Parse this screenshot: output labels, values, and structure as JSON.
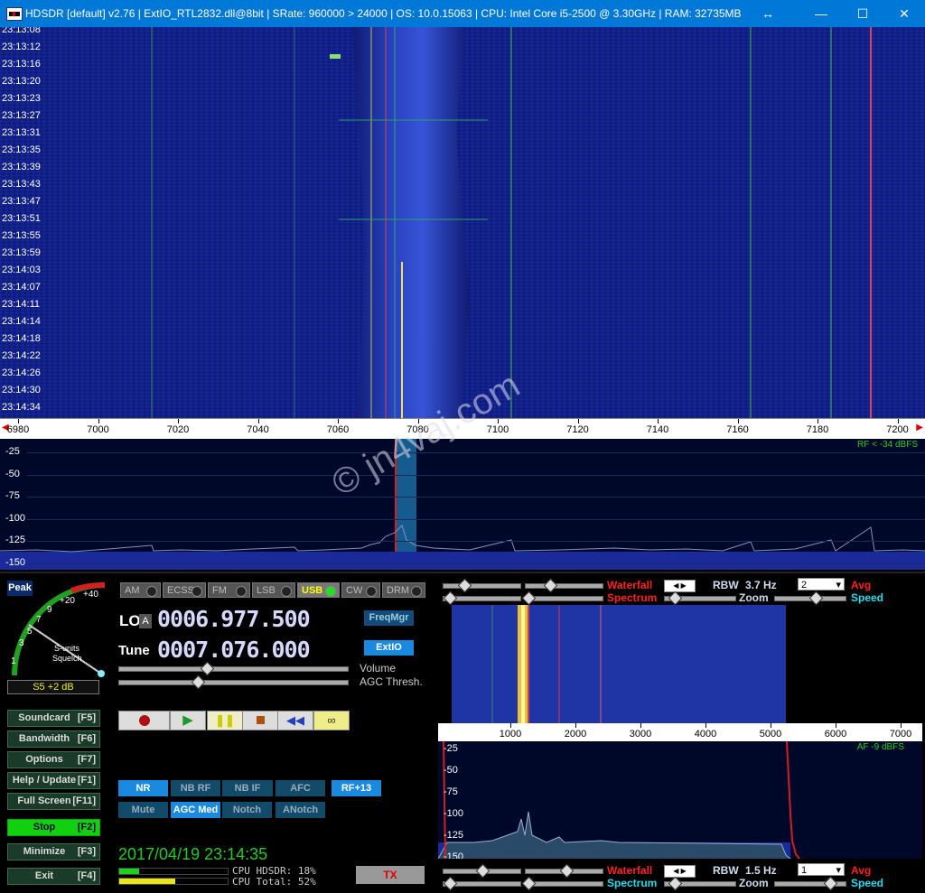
{
  "titlebar": {
    "title": "HDSDR  [default]  v2.76   |  ExtIO_RTL2832.dll@8bit  |  SRate: 960000 > 24000  |  OS: 10.0.15063   |  CPU: Intel Core i5-2500 @ 3.30GHz  |  RAM: 32735MB",
    "resize_icon": "↔",
    "minimize": "—",
    "maximize": "☐",
    "close": "✕"
  },
  "waterfall": {
    "timestamps": [
      "23:13:08",
      "23:13:12",
      "23:13:16",
      "23:13:20",
      "23:13:23",
      "23:13:27",
      "23:13:31",
      "23:13:35",
      "23:13:39",
      "23:13:43",
      "23:13:47",
      "23:13:51",
      "23:13:55",
      "23:13:59",
      "23:14:03",
      "23:14:07",
      "23:14:11",
      "23:14:14",
      "23:14:18",
      "23:14:22",
      "23:14:26",
      "23:14:30",
      "23:14:34"
    ],
    "freq_ticks": [
      "6980",
      "7000",
      "7020",
      "7040",
      "7060",
      "7080",
      "7100",
      "7120",
      "7140",
      "7160",
      "7180",
      "7200"
    ],
    "watermark": "© jn4vaj.com"
  },
  "spectrum": {
    "db_labels": [
      "-25",
      "-50",
      "-75",
      "-100",
      "-125",
      "-150"
    ],
    "rf_level": "RF < -34 dBFS"
  },
  "smeter": {
    "peak": "Peak",
    "scale": [
      "1",
      "3",
      "5",
      "7",
      "9",
      "+20",
      "+40"
    ],
    "squelch_label": "S-units",
    "squelch_label2": "Squelch",
    "reading": "S5 +2 dB"
  },
  "modes": [
    {
      "label": "AM",
      "active": false
    },
    {
      "label": "ECSS",
      "active": false
    },
    {
      "label": "FM",
      "active": false
    },
    {
      "label": "LSB",
      "active": false
    },
    {
      "label": "USB",
      "active": true
    },
    {
      "label": "CW",
      "active": false
    },
    {
      "label": "DRM",
      "active": false
    }
  ],
  "lo": {
    "label": "LO",
    "badge": "A",
    "value": "0006.977.500"
  },
  "tune": {
    "label": "Tune",
    "value": "0007.076.000"
  },
  "buttons_right": {
    "freqmgr": "FreqMgr",
    "extio": "ExtIO"
  },
  "volume_label": "Volume",
  "agc_thresh_label": "AGC Thresh.",
  "func_buttons": [
    {
      "label": "Soundcard",
      "key": "[F5]"
    },
    {
      "label": "Bandwidth",
      "key": "[F6]"
    },
    {
      "label": "Options",
      "key": "[F7]"
    },
    {
      "label": "Help / Update",
      "key": "[F1]"
    },
    {
      "label": "Full Screen",
      "key": "[F11]"
    },
    {
      "label": "Stop",
      "key": "[F2]"
    },
    {
      "label": "Minimize",
      "key": "[F3]"
    },
    {
      "label": "Exit",
      "key": "[F4]"
    }
  ],
  "dsp_row1": [
    "NR",
    "NB RF",
    "NB IF",
    "AFC",
    "RF+13"
  ],
  "dsp_row2": [
    "Mute",
    "AGC Med",
    "Notch",
    "ANotch"
  ],
  "datetime": "2017/04/19 23:14:35",
  "cpu": {
    "hdsdr": "CPU HDSDR:  18%",
    "total": "CPU Total:  52%",
    "hdsdr_frac": 0.18,
    "total_frac": 0.52
  },
  "tx": "TX",
  "top_ctrl": {
    "waterfall": "Waterfall",
    "spectrum": "Spectrum",
    "rbw": "RBW",
    "rbw_val": "3.7 Hz",
    "zoom": "Zoom",
    "avg_val": "2",
    "avg": "Avg",
    "speed": "Speed"
  },
  "bottom_ctrl": {
    "waterfall": "Waterfall",
    "spectrum": "Spectrum",
    "rbw": "RBW",
    "rbw_val": "1.5 Hz",
    "zoom": "Zoom",
    "avg_val": "1",
    "avg": "Avg",
    "speed": "Speed"
  },
  "af_axis": [
    "1000",
    "2000",
    "3000",
    "4000",
    "5000",
    "6000",
    "7000"
  ],
  "af_db_labels": [
    "-25",
    "-50",
    "-75",
    "-100",
    "-125",
    "-150"
  ],
  "af_level": "AF  -9 dBFS",
  "colors": {
    "accent_red": "#ff2020",
    "accent_cyan": "#22ddee",
    "green_text": "#22cc22",
    "wf_blue": "#1a2a9a"
  }
}
